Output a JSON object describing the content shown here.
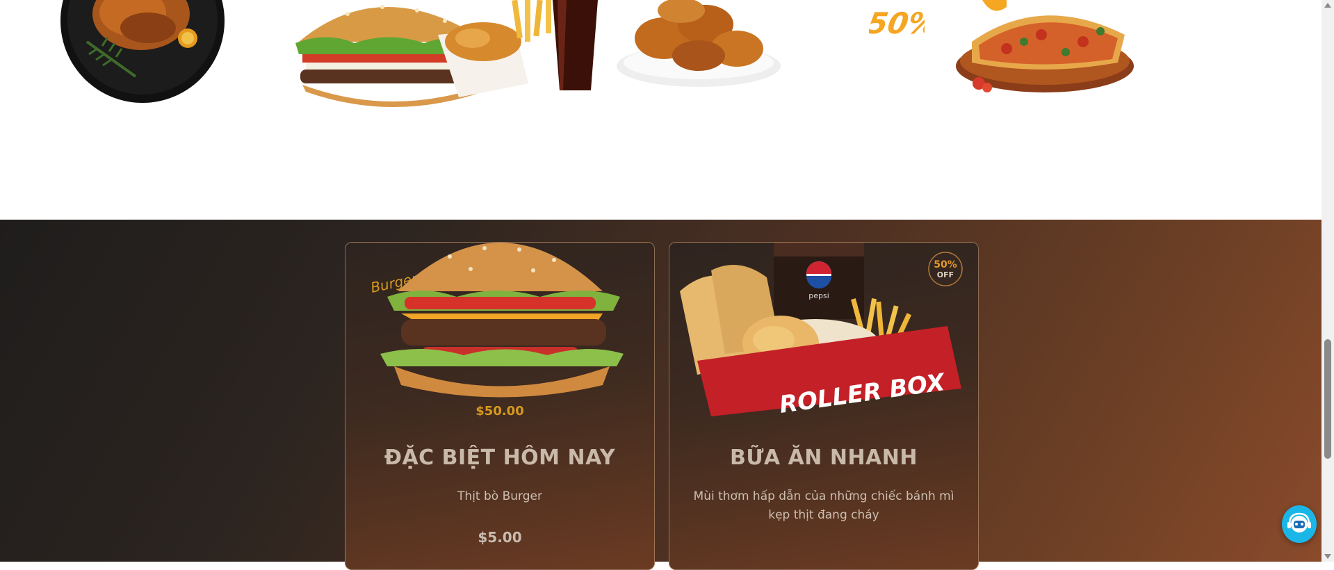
{
  "food_strip": {
    "items": [
      {
        "icon": "roast-chicken-plate"
      },
      {
        "icon": "burger-combo"
      },
      {
        "icon": "fried-chicken-plate"
      },
      {
        "icon": "discount-50-badge",
        "text": "50%"
      },
      {
        "icon": "pizza-board"
      }
    ]
  },
  "promo_cards": [
    {
      "title": "ĐẶC BIỆT HÔM NAY",
      "description": "Thịt bò Burger",
      "price": "$5.00",
      "image_icon": "cheeseburger",
      "image_text": "Burger",
      "image_price_text": "$50.00"
    },
    {
      "title": "BỮA ĂN NHANH",
      "description": "Mùi thơm hấp dẫn của những chiếc bánh mì kẹp thịt đang cháy",
      "image_icon": "roller-box-combo",
      "box_text": "ROLLER BOX",
      "badge_top": "50%",
      "badge_bottom": "OFF",
      "cup_text": "pepsi"
    }
  ],
  "chat_widget": {
    "icon": "chat-bot-icon"
  },
  "colors": {
    "accent": "#f5a623",
    "card_border": "#d6aa82",
    "chat_button": "#1bb6e8",
    "section_dark": "#1f1d1c",
    "section_warm": "#8a4a2b"
  }
}
